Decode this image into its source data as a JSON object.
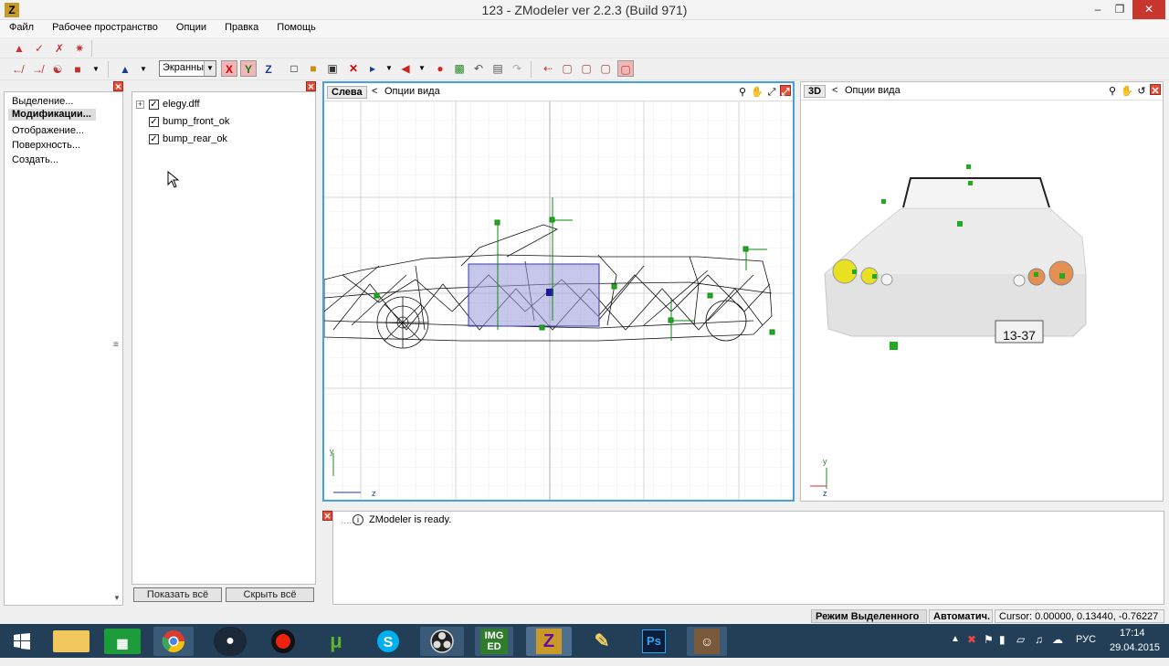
{
  "window": {
    "title": "123 - ZModeler ver 2.2.3 (Build 971)",
    "icon": "Z",
    "minimize": "–",
    "restore": "❐",
    "close": "✕"
  },
  "menu": [
    "Файл",
    "Рабочее пространство",
    "Опции",
    "Правка",
    "Помощь"
  ],
  "toolbar": {
    "view_mode": "Экранны",
    "axes": [
      "X",
      "Y",
      "Z"
    ]
  },
  "command_panel": {
    "items": [
      "Выделение...",
      "Модификации...",
      "Отображение...",
      "Поверхность...",
      "Создать..."
    ],
    "active_index": 1
  },
  "object_tree": {
    "items": [
      {
        "label": "elegy.dff",
        "checked": true,
        "expandable": true
      },
      {
        "label": "bump_front_ok",
        "checked": true,
        "expandable": false
      },
      {
        "label": "bump_rear_ok",
        "checked": true,
        "expandable": false
      }
    ],
    "show_all": "Показать всё",
    "hide_all": "Скрыть всё"
  },
  "viewports": {
    "left": {
      "label": "Слева",
      "nav": "<",
      "options": "Опции вида",
      "axis_y": "y",
      "axis_x": "z"
    },
    "threed": {
      "label": "3D",
      "nav": "<",
      "options": "Опции вида",
      "axis_y": "y",
      "axis_x": "z"
    }
  },
  "car_plate": "13-37",
  "log": {
    "message": "ZModeler is ready.",
    "prefix": "....."
  },
  "status": {
    "mode": "Режим Выделенного",
    "auto": "Автоматич.",
    "cursor": "Cursor: 0.00000, 0.13440, -0.76227"
  },
  "taskbar": {
    "apps": [
      "explorer",
      "store",
      "chrome",
      "steam",
      "record",
      "utorrent",
      "skype",
      "obs",
      "img-ed",
      "zmodeler",
      "paint",
      "photoshop",
      "gta"
    ],
    "img_ed_label": "IMG ED",
    "ps_label": "Ps",
    "lang": "РУС",
    "time": "17:14",
    "date": "29.04.2015"
  },
  "colors": {
    "viewport_border": "#49a0e0",
    "selection_fill": "#9999dd",
    "helper_green": "#22aa22",
    "taskbar": "#233f58"
  }
}
